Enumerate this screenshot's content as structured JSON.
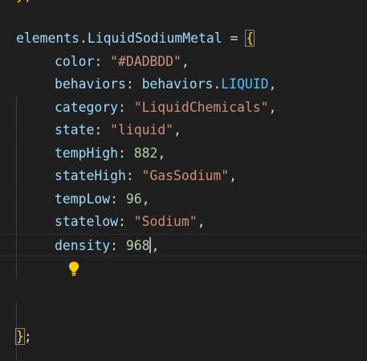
{
  "editor": {
    "top_fragment": {
      "brace": "}",
      "semi": ";"
    },
    "header": {
      "obj": "elements",
      "dot": ".",
      "prop": "LiquidSodiumMetal",
      "op": " = ",
      "brace": "{"
    },
    "props": [
      {
        "key": "color",
        "colon": ": ",
        "value": "\"#DADBDD\"",
        "type": "string",
        "comma": ","
      },
      {
        "key": "behaviors",
        "colon": ": ",
        "value_obj": "behaviors",
        "value_dot": ".",
        "value_const": "LIQUID",
        "type": "member",
        "comma": ","
      },
      {
        "key": "category",
        "colon": ": ",
        "value": "\"LiquidChemicals\"",
        "type": "string",
        "comma": ","
      },
      {
        "key": "state",
        "colon": ": ",
        "value": "\"liquid\"",
        "type": "string",
        "comma": ","
      },
      {
        "key": "tempHigh",
        "colon": ": ",
        "value": "882",
        "type": "number",
        "comma": ","
      },
      {
        "key": "stateHigh",
        "colon": ": ",
        "value": "\"GasSodium\"",
        "type": "string",
        "comma": ","
      },
      {
        "key": "tempLow",
        "colon": ": ",
        "value": "96",
        "type": "number",
        "comma": ","
      },
      {
        "key": "statelow",
        "colon": ": ",
        "value": "\"Sodium\"",
        "type": "string",
        "comma": ","
      },
      {
        "key": "density",
        "colon": ": ",
        "value": "968",
        "type": "number",
        "comma": ","
      }
    ],
    "footer": {
      "brace": "}",
      "semi": ";"
    },
    "lightbulb_icon": "lightbulb-icon",
    "colors": {
      "background": "#1f1f1f",
      "property": "#9cdcfe",
      "string": "#ce9178",
      "number": "#b5cea8",
      "constant": "#4fc1ff",
      "bracket": "#ffd700",
      "lightbulb": "#ffcc00"
    }
  }
}
